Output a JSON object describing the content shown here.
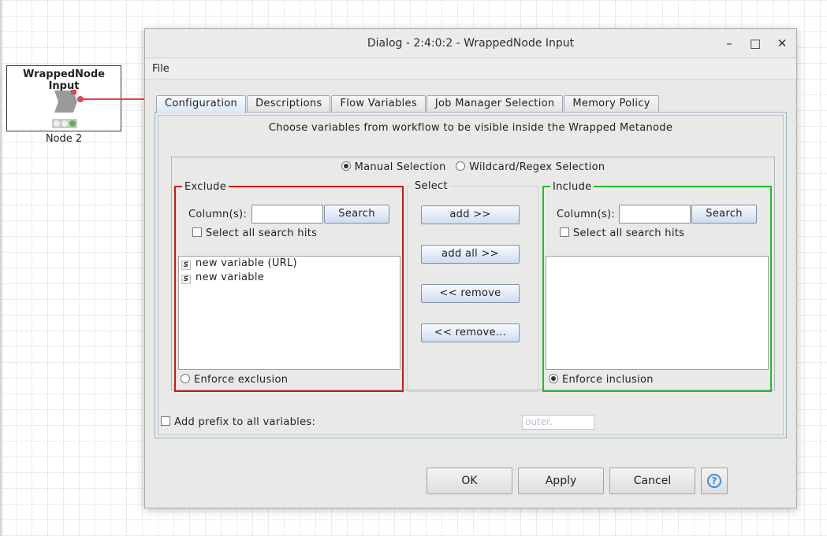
{
  "canvas": {
    "node_title": "WrappedNode Input",
    "node_label": "Node 2"
  },
  "dialog": {
    "title": "Dialog - 2:4:0:2 - WrappedNode Input",
    "window_controls": {
      "minimize": "–",
      "maximize": "□",
      "close": "✕"
    },
    "menu": {
      "file": "File"
    },
    "tabs": [
      "Configuration",
      "Descriptions",
      "Flow Variables",
      "Job Manager Selection",
      "Memory Policy"
    ],
    "heading": "Choose variables from workflow to be visible inside the Wrapped Metanode",
    "mode": {
      "manual": "Manual Selection",
      "wildcard": "Wildcard/Regex Selection"
    },
    "exclude": {
      "title": "Exclude",
      "column_label": "Column(s):",
      "search_button": "Search",
      "select_all": "Select all search hits",
      "items": [
        "new variable (URL)",
        "new variable"
      ],
      "enforce": "Enforce exclusion"
    },
    "select": {
      "title": "Select",
      "add": "add >>",
      "add_all": "add all >>",
      "remove": "<< remove",
      "remove_all": "<< remove..."
    },
    "include": {
      "title": "Include",
      "column_label": "Column(s):",
      "search_button": "Search",
      "select_all": "Select all search hits",
      "enforce": "Enforce inclusion"
    },
    "prefix": {
      "label": "Add prefix to all variables:",
      "placeholder": "outer."
    },
    "footer": {
      "ok": "OK",
      "apply": "Apply",
      "cancel": "Cancel"
    }
  },
  "colors": {
    "exclude_border": "#d01717",
    "include_border": "#1fbd29",
    "help_accent": "#3c8fd8"
  }
}
